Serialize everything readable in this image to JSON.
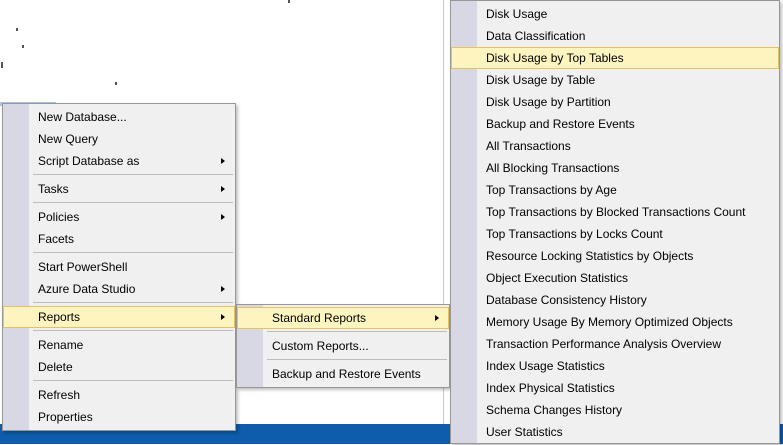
{
  "context_menu": {
    "groups": [
      [
        {
          "label": "New Database..."
        },
        {
          "label": "New Query"
        },
        {
          "label": "Script Database as",
          "submenu": true
        }
      ],
      [
        {
          "label": "Tasks",
          "submenu": true
        }
      ],
      [
        {
          "label": "Policies",
          "submenu": true
        },
        {
          "label": "Facets"
        }
      ],
      [
        {
          "label": "Start PowerShell"
        },
        {
          "label": "Azure Data Studio",
          "submenu": true
        }
      ],
      [
        {
          "label": "Reports",
          "submenu": true,
          "active": true
        }
      ],
      [
        {
          "label": "Rename"
        },
        {
          "label": "Delete"
        }
      ],
      [
        {
          "label": "Refresh"
        },
        {
          "label": "Properties"
        }
      ]
    ]
  },
  "reports_menu": {
    "groups": [
      [
        {
          "label": "Standard Reports",
          "submenu": true,
          "active": true
        }
      ],
      [
        {
          "label": "Custom Reports..."
        }
      ],
      [
        {
          "label": "Backup and Restore Events"
        }
      ]
    ]
  },
  "standard_reports_menu": {
    "items": [
      {
        "label": "Disk Usage"
      },
      {
        "label": "Data Classification"
      },
      {
        "label": "Disk Usage by Top Tables",
        "active": true
      },
      {
        "label": "Disk Usage by Table"
      },
      {
        "label": "Disk Usage by Partition"
      },
      {
        "label": "Backup and Restore Events"
      },
      {
        "label": "All Transactions"
      },
      {
        "label": "All Blocking Transactions"
      },
      {
        "label": "Top Transactions by Age"
      },
      {
        "label": "Top Transactions by Blocked Transactions Count"
      },
      {
        "label": "Top Transactions by Locks Count"
      },
      {
        "label": "Resource Locking Statistics by Objects"
      },
      {
        "label": "Object Execution Statistics"
      },
      {
        "label": "Database Consistency History"
      },
      {
        "label": "Memory Usage By Memory Optimized Objects"
      },
      {
        "label": "Transaction Performance Analysis Overview"
      },
      {
        "label": "Index Usage Statistics"
      },
      {
        "label": "Index Physical Statistics"
      },
      {
        "label": "Schema Changes History"
      },
      {
        "label": "User Statistics"
      }
    ]
  },
  "colors": {
    "menu_bg": "#f0f0f0",
    "gutter": "#d8d8e4",
    "highlight": "#fdf4bf",
    "highlight_border": "#e5c365",
    "taskbar": "#0e5cab"
  }
}
